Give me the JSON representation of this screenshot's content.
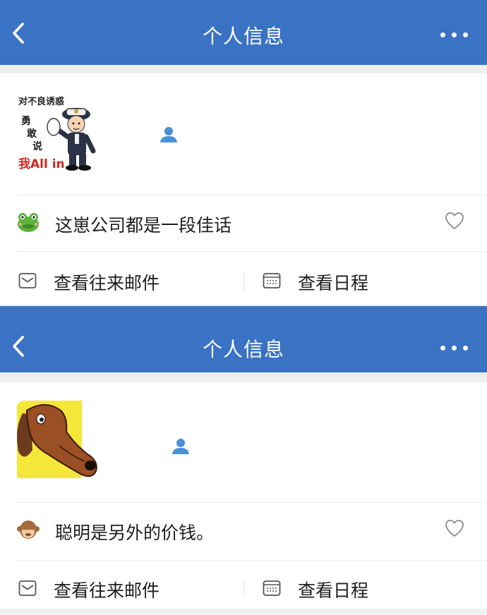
{
  "profiles": [
    {
      "nav": {
        "title": "个人信息",
        "back_icon": "chevron-left-icon",
        "more_icon": "more-horizontal-icon"
      },
      "avatar": {
        "description": "police-cartoon-sticker",
        "sticker_text": [
          "对不良诱惑",
          "勇",
          "敢",
          "说",
          "我All in"
        ]
      },
      "person_icon": "person-icon",
      "signature": {
        "emoji": "frog-emoji",
        "text": "这崽公司都是一段佳话",
        "like_icon": "heart-icon"
      },
      "actions": [
        {
          "label": "查看往来邮件",
          "icon": "mail-icon"
        },
        {
          "label": "查看日程",
          "icon": "calendar-icon"
        }
      ]
    },
    {
      "nav": {
        "title": "个人信息",
        "back_icon": "chevron-left-icon",
        "more_icon": "more-horizontal-icon"
      },
      "avatar": {
        "description": "long-nose-dog-cartoon"
      },
      "person_icon": "person-icon",
      "signature": {
        "emoji": "monkey-emoji",
        "text": "聪明是另外的价钱。",
        "like_icon": "heart-icon"
      },
      "actions": [
        {
          "label": "查看往来邮件",
          "icon": "mail-icon"
        },
        {
          "label": "查看日程",
          "icon": "calendar-icon"
        }
      ]
    }
  ],
  "colors": {
    "navbar": "#3a72c4",
    "accent_icon": "#4a90d9",
    "divider": "#ececec"
  }
}
